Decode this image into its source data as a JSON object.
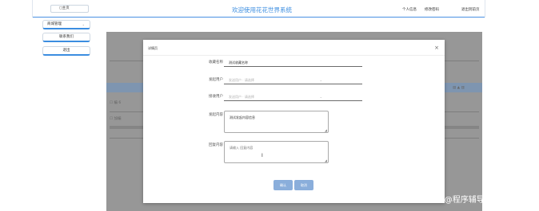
{
  "header": {
    "home_tab": "◻主页",
    "title": "欢迎使用花花世界系统",
    "links": [
      "个人信息",
      "修改密码",
      "退出到前页"
    ]
  },
  "sidebar": {
    "items": [
      {
        "label": "商城管理",
        "has_chevron": true
      },
      {
        "label": "联系我们",
        "has_chevron": false
      },
      {
        "label": "退出",
        "has_chevron": false
      }
    ]
  },
  "background": {
    "checkbox_row1": "编",
    "checkbox_row2": "加编",
    "col_mark": "6"
  },
  "dialog": {
    "title": "详情页",
    "close_icon": "×",
    "fields": {
      "product_name": {
        "label": "收藏名称",
        "value": "测试收藏名称"
      },
      "sender_user": {
        "label": "发起用户",
        "placeholder": "发送用户 · 请选择"
      },
      "receiver_user": {
        "label": "接收用户",
        "placeholder": "发送用户 · 请选择"
      },
      "send_content": {
        "label": "发起内容",
        "value": "测试发起内容信息"
      },
      "reply_content": {
        "label": "回复内容",
        "placeholder": "请输入 回复内容"
      }
    },
    "buttons": {
      "confirm": "确认",
      "cancel": "取消"
    }
  },
  "watermark": "CSDN @程序辅导开发"
}
